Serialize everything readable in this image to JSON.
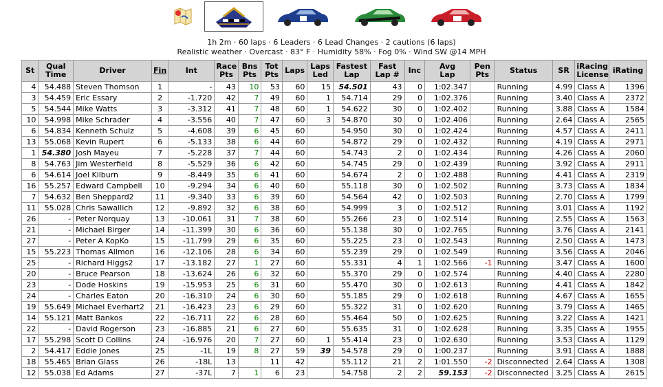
{
  "icons": [
    {
      "name": "map-icon"
    },
    {
      "name": "indianapolis-motor-speedway-logo"
    },
    {
      "name": "car-blue-icon"
    },
    {
      "name": "car-green-icon"
    },
    {
      "name": "car-red-icon"
    }
  ],
  "info": {
    "line1": "1h 2m · 60 laps · 6 Leaders · 6 Lead Changes · 2 cautions (6 laps)",
    "line2": "Realistic weather · Overcast · 83° F · Humidity 58% · Fog 0% · Wind SW @14 MPH"
  },
  "columns": [
    {
      "key": "st",
      "label1": "St",
      "label2": ""
    },
    {
      "key": "qual",
      "label1": "Qual",
      "label2": "Time"
    },
    {
      "key": "driver",
      "label1": "Driver",
      "label2": ""
    },
    {
      "key": "fin",
      "label1": "Fin",
      "label2": ""
    },
    {
      "key": "int",
      "label1": "Int",
      "label2": ""
    },
    {
      "key": "race_pts",
      "label1": "Race",
      "label2": "Pts"
    },
    {
      "key": "bns_pts",
      "label1": "Bns",
      "label2": "Pts"
    },
    {
      "key": "tot_pts",
      "label1": "Tot",
      "label2": "Pts"
    },
    {
      "key": "laps",
      "label1": "Laps",
      "label2": ""
    },
    {
      "key": "laps_led",
      "label1": "Laps",
      "label2": "Led"
    },
    {
      "key": "fastest_lap",
      "label1": "Fastest",
      "label2": "Lap"
    },
    {
      "key": "fast_lap_no",
      "label1": "Fast",
      "label2": "Lap #"
    },
    {
      "key": "inc",
      "label1": "Inc",
      "label2": ""
    },
    {
      "key": "avg_lap",
      "label1": "Avg",
      "label2": "Lap"
    },
    {
      "key": "pen_pts",
      "label1": "Pen",
      "label2": "Pts"
    },
    {
      "key": "status",
      "label1": "Status",
      "label2": ""
    },
    {
      "key": "sr",
      "label1": "SR",
      "label2": ""
    },
    {
      "key": "license",
      "label1": "iRacing",
      "label2": "License"
    },
    {
      "key": "irating",
      "label1": "iRating",
      "label2": ""
    }
  ],
  "rows": [
    [
      "4",
      "54.488",
      "Steven Thomson",
      "1",
      "-",
      "43",
      "10",
      "53",
      "60",
      "15",
      "54.501",
      "43",
      "0",
      "1:02.347",
      "",
      "Running",
      "4.99",
      "Class A",
      "1396"
    ],
    [
      "3",
      "54.459",
      "Eric Essary",
      "2",
      "-1.720",
      "42",
      "7",
      "49",
      "60",
      "1",
      "54.714",
      "29",
      "0",
      "1:02.376",
      "",
      "Running",
      "3.40",
      "Class A",
      "2372"
    ],
    [
      "5",
      "54.544",
      "Mike Watts",
      "3",
      "-3.312",
      "41",
      "7",
      "48",
      "60",
      "1",
      "54.622",
      "30",
      "0",
      "1:02.402",
      "",
      "Running",
      "3.88",
      "Class A",
      "1584"
    ],
    [
      "10",
      "54.998",
      "Mike Schrader",
      "4",
      "-3.556",
      "40",
      "7",
      "47",
      "60",
      "3",
      "54.870",
      "30",
      "0",
      "1:02.406",
      "",
      "Running",
      "2.64",
      "Class A",
      "2565"
    ],
    [
      "6",
      "54.834",
      "Kenneth Schulz",
      "5",
      "-4.608",
      "39",
      "6",
      "45",
      "60",
      "",
      "54.950",
      "30",
      "0",
      "1:02.424",
      "",
      "Running",
      "4.57",
      "Class A",
      "2411"
    ],
    [
      "13",
      "55.068",
      "Kevin Rupert",
      "6",
      "-5.133",
      "38",
      "6",
      "44",
      "60",
      "",
      "54.872",
      "29",
      "0",
      "1:02.432",
      "",
      "Running",
      "4.19",
      "Class A",
      "2971"
    ],
    [
      "1",
      "54.380",
      "Josh Mayeu",
      "7",
      "-5.228",
      "37",
      "7",
      "44",
      "60",
      "",
      "54.743",
      "2",
      "0",
      "1:02.434",
      "",
      "Running",
      "4.26",
      "Class A",
      "2060"
    ],
    [
      "8",
      "54.763",
      "Jim Westerfield",
      "8",
      "-5.529",
      "36",
      "6",
      "42",
      "60",
      "",
      "54.745",
      "29",
      "0",
      "1:02.439",
      "",
      "Running",
      "3.92",
      "Class A",
      "2911"
    ],
    [
      "6",
      "54.614",
      "Joel Kilburn",
      "9",
      "-8.449",
      "35",
      "6",
      "41",
      "60",
      "",
      "54.674",
      "2",
      "0",
      "1:02.488",
      "",
      "Running",
      "4.41",
      "Class A",
      "2319"
    ],
    [
      "16",
      "55.257",
      "Edward Campbell",
      "10",
      "-9.294",
      "34",
      "6",
      "40",
      "60",
      "",
      "55.118",
      "30",
      "0",
      "1:02.502",
      "",
      "Running",
      "3.73",
      "Class A",
      "1834"
    ],
    [
      "7",
      "54.632",
      "Ben Sheppard2",
      "11",
      "-9.340",
      "33",
      "6",
      "39",
      "60",
      "",
      "54.564",
      "42",
      "0",
      "1:02.503",
      "",
      "Running",
      "2.70",
      "Class A",
      "1799"
    ],
    [
      "11",
      "55.028",
      "Chris Sawallich",
      "12",
      "-9.892",
      "32",
      "6",
      "38",
      "60",
      "",
      "54.999",
      "3",
      "0",
      "1:02.512",
      "",
      "Running",
      "3.01",
      "Class A",
      "1192"
    ],
    [
      "26",
      "-",
      "Peter Norquay",
      "13",
      "-10.061",
      "31",
      "7",
      "38",
      "60",
      "",
      "55.266",
      "23",
      "0",
      "1:02.514",
      "",
      "Running",
      "2.55",
      "Class A",
      "1563"
    ],
    [
      "21",
      "-",
      "Michael Birger",
      "14",
      "-11.399",
      "30",
      "6",
      "36",
      "60",
      "",
      "55.138",
      "30",
      "0",
      "1:02.765",
      "",
      "Running",
      "3.76",
      "Class A",
      "2141"
    ],
    [
      "27",
      "-",
      "Peter A KopKo",
      "15",
      "-11.799",
      "29",
      "6",
      "35",
      "60",
      "",
      "55.225",
      "23",
      "0",
      "1:02.543",
      "",
      "Running",
      "2.50",
      "Class A",
      "1473"
    ],
    [
      "15",
      "55.223",
      "Thomas Allmon",
      "16",
      "-12.106",
      "28",
      "6",
      "34",
      "60",
      "",
      "55.239",
      "29",
      "0",
      "1:02.549",
      "",
      "Running",
      "3.56",
      "Class A",
      "2046"
    ],
    [
      "25",
      "-",
      "Richard Higgs2",
      "17",
      "-13.182",
      "27",
      "1",
      "27",
      "60",
      "",
      "55.331",
      "4",
      "1",
      "1:02.566",
      "-1",
      "Running",
      "3.47",
      "Class A",
      "1600"
    ],
    [
      "20",
      "-",
      "Bruce Pearson",
      "18",
      "-13.624",
      "26",
      "6",
      "32",
      "60",
      "",
      "55.370",
      "29",
      "0",
      "1:02.574",
      "",
      "Running",
      "4.40",
      "Class A",
      "2280"
    ],
    [
      "23",
      "-",
      "Dode Hoskins",
      "19",
      "-15.953",
      "25",
      "6",
      "31",
      "60",
      "",
      "55.470",
      "30",
      "0",
      "1:02.613",
      "",
      "Running",
      "4.41",
      "Class A",
      "1842"
    ],
    [
      "24",
      "-",
      "Charles Eaton",
      "20",
      "-16.310",
      "24",
      "6",
      "30",
      "60",
      "",
      "55.185",
      "29",
      "0",
      "1:02.618",
      "",
      "Running",
      "4.67",
      "Class A",
      "1655"
    ],
    [
      "19",
      "55.649",
      "Michael Everhart2",
      "21",
      "-16.423",
      "23",
      "6",
      "29",
      "60",
      "",
      "55.322",
      "31",
      "0",
      "1:02.620",
      "",
      "Running",
      "3.79",
      "Class A",
      "1465"
    ],
    [
      "14",
      "55.121",
      "Matt Bankos",
      "22",
      "-16.711",
      "22",
      "6",
      "28",
      "60",
      "",
      "55.464",
      "50",
      "0",
      "1:02.625",
      "",
      "Running",
      "3.22",
      "Class A",
      "1421"
    ],
    [
      "22",
      "-",
      "David Rogerson",
      "23",
      "-16.885",
      "21",
      "6",
      "27",
      "60",
      "",
      "55.635",
      "31",
      "0",
      "1:02.628",
      "",
      "Running",
      "3.35",
      "Class A",
      "1955"
    ],
    [
      "17",
      "55.298",
      "Scott D Collins",
      "24",
      "-16.976",
      "20",
      "7",
      "27",
      "60",
      "1",
      "55.414",
      "23",
      "0",
      "1:02.630",
      "",
      "Running",
      "3.53",
      "Class A",
      "1129"
    ],
    [
      "2",
      "54.417",
      "Eddie Jones",
      "25",
      "-1L",
      "19",
      "8",
      "27",
      "59",
      "39",
      "54.578",
      "29",
      "0",
      "1:00.237",
      "",
      "Running",
      "3.91",
      "Class A",
      "1888"
    ],
    [
      "18",
      "55.465",
      "Brian Glass",
      "26",
      "-18L",
      "13",
      "",
      "11",
      "42",
      "",
      "55.112",
      "21",
      "2",
      "1:01.550",
      "-2",
      "Disconnected",
      "2.64",
      "Class A",
      "1308"
    ],
    [
      "12",
      "55.038",
      "Ed Adams",
      "27",
      "-37L",
      "7",
      "1",
      "6",
      "23",
      "",
      "54.758",
      "2",
      "2",
      "59.153",
      "-2",
      "Disconnected",
      "3.25",
      "Class A",
      "2615"
    ]
  ],
  "highlights": {
    "best_qual_row": 6,
    "best_fastest_lap_row": 0,
    "most_laps_led_row": 24,
    "best_avg_lap_row": 26
  }
}
